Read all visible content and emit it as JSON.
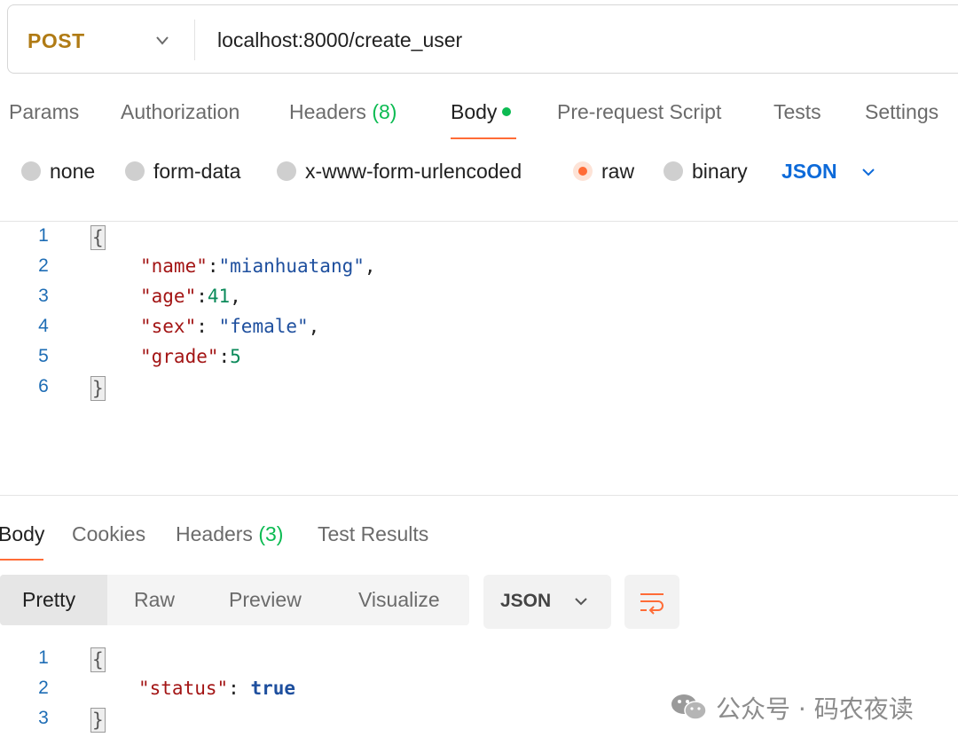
{
  "request": {
    "method": "POST",
    "url": "localhost:8000/create_user",
    "tabs": [
      {
        "label": "Params"
      },
      {
        "label": "Authorization"
      },
      {
        "label": "Headers",
        "count": "(8)"
      },
      {
        "label": "Body"
      },
      {
        "label": "Pre-request Script"
      },
      {
        "label": "Tests"
      },
      {
        "label": "Settings"
      }
    ],
    "body_types": [
      "none",
      "form-data",
      "x-www-form-urlencoded",
      "raw",
      "binary"
    ],
    "selected_body_type": "raw",
    "raw_format": "JSON",
    "code_lines": [
      {
        "num": "1"
      },
      {
        "num": "2",
        "key": "\"name\"",
        "sep": ":",
        "value": "\"mianhuatang\"",
        "tail": ","
      },
      {
        "num": "3",
        "key": "\"age\"",
        "sep": ":",
        "value": "41",
        "tail": ","
      },
      {
        "num": "4",
        "key": "\"sex\"",
        "sep": ": ",
        "value": "\"female\"",
        "tail": ","
      },
      {
        "num": "5",
        "key": "\"grade\"",
        "sep": ":",
        "value": "5",
        "tail": ""
      },
      {
        "num": "6"
      }
    ],
    "open_brace": "{",
    "close_brace": "}"
  },
  "response": {
    "tabs": [
      {
        "label": "Body"
      },
      {
        "label": "Cookies"
      },
      {
        "label": "Headers",
        "count": "(3)"
      },
      {
        "label": "Test Results"
      }
    ],
    "views": [
      "Pretty",
      "Raw",
      "Preview",
      "Visualize"
    ],
    "active_view": "Pretty",
    "format": "JSON",
    "code_lines": [
      {
        "num": "1"
      },
      {
        "num": "2",
        "key": "\"status\"",
        "sep": ": ",
        "value": "true"
      },
      {
        "num": "3"
      }
    ]
  },
  "watermark": {
    "text": "公众号 · 码农夜读",
    "icon": "wechat-icon"
  },
  "colors": {
    "method": "#b07b15",
    "accent": "#ff6c37",
    "count_green": "#0cbb52",
    "link_blue": "#0d6ad9"
  }
}
